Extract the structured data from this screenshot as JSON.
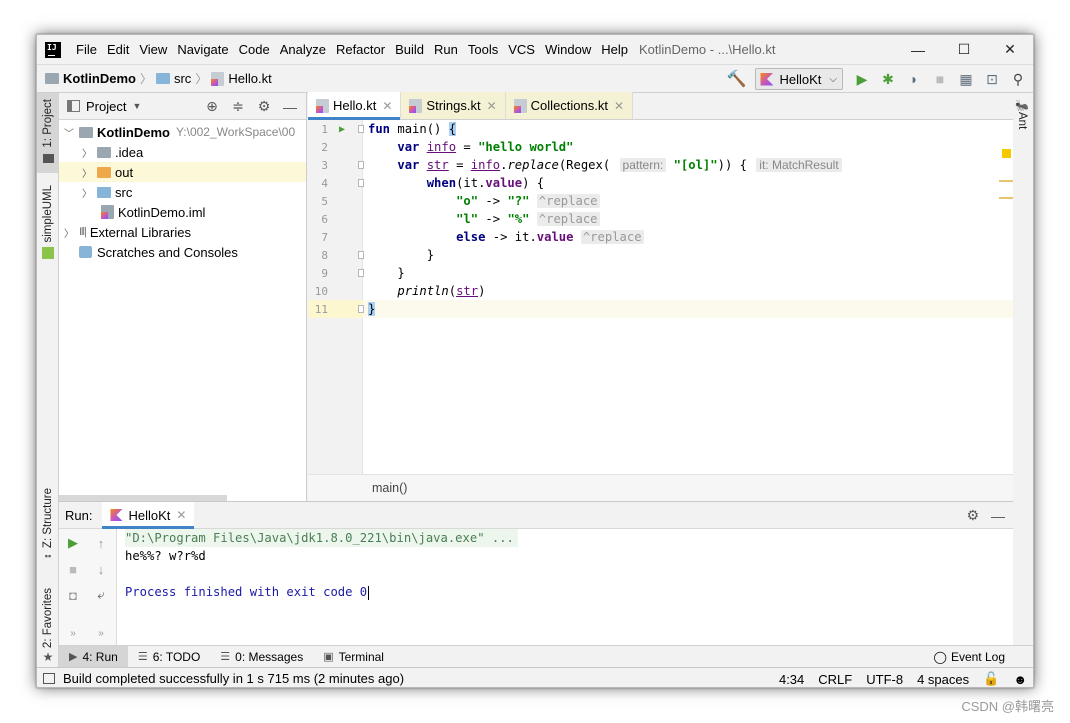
{
  "menu": {
    "logo": "IJ",
    "items": [
      "File",
      "Edit",
      "View",
      "Navigate",
      "Code",
      "Analyze",
      "Refactor",
      "Build",
      "Run",
      "Tools",
      "VCS",
      "Window",
      "Help"
    ],
    "title": "KotlinDemo - ...\\Hello.kt"
  },
  "window_buttons": {
    "minimize": "—",
    "maximize": "☐",
    "close": "✕"
  },
  "navbar": {
    "crumbs": [
      "KotlinDemo",
      "src",
      "Hello.kt"
    ],
    "run_config": "HelloKt"
  },
  "left_strip": {
    "project": "1: Project",
    "uml": "simpleUML",
    "structure": "Z: Structure",
    "favorites": "2: Favorites"
  },
  "right_strip": {
    "ant": "Ant"
  },
  "project_pane": {
    "title": "Project",
    "tree": [
      {
        "label": "KotlinDemo",
        "path": "Y:\\002_WorkSpace\\00"
      },
      {
        "label": ".idea"
      },
      {
        "label": "out"
      },
      {
        "label": "src"
      },
      {
        "label": "KotlinDemo.iml"
      },
      {
        "label": "External Libraries"
      },
      {
        "label": "Scratches and Consoles"
      }
    ]
  },
  "editor": {
    "tabs": [
      "Hello.kt",
      "Strings.kt",
      "Collections.kt"
    ],
    "line_numbers": [
      "1",
      "2",
      "3",
      "4",
      "5",
      "6",
      "7",
      "8",
      "9",
      "10",
      "11"
    ],
    "hint_pattern": "pattern:",
    "hint_type": "it: MatchResult",
    "hint_replace": "^replace",
    "breadcrumb": "main()"
  },
  "run_panel": {
    "label": "Run:",
    "tab": "HelloKt",
    "console": {
      "command": "\"D:\\Program Files\\Java\\jdk1.8.0_221\\bin\\java.exe\" ...",
      "output": "he%%? w?r%d",
      "exit": "Process finished with exit code 0"
    }
  },
  "bottom_tabs": {
    "run": "4: Run",
    "todo": "6: TODO",
    "messages": "0: Messages",
    "terminal": "Terminal",
    "event_log": "Event Log"
  },
  "status": {
    "message": "Build completed successfully in 1 s 715 ms (2 minutes ago)",
    "position": "4:34",
    "line_sep": "CRLF",
    "encoding": "UTF-8",
    "indent": "4 spaces"
  },
  "watermark": "CSDN @韩曙亮",
  "colors": {
    "accent": "#4083c9",
    "keyword": "#000080",
    "string": "#008000",
    "run_green": "#4c9f38"
  }
}
